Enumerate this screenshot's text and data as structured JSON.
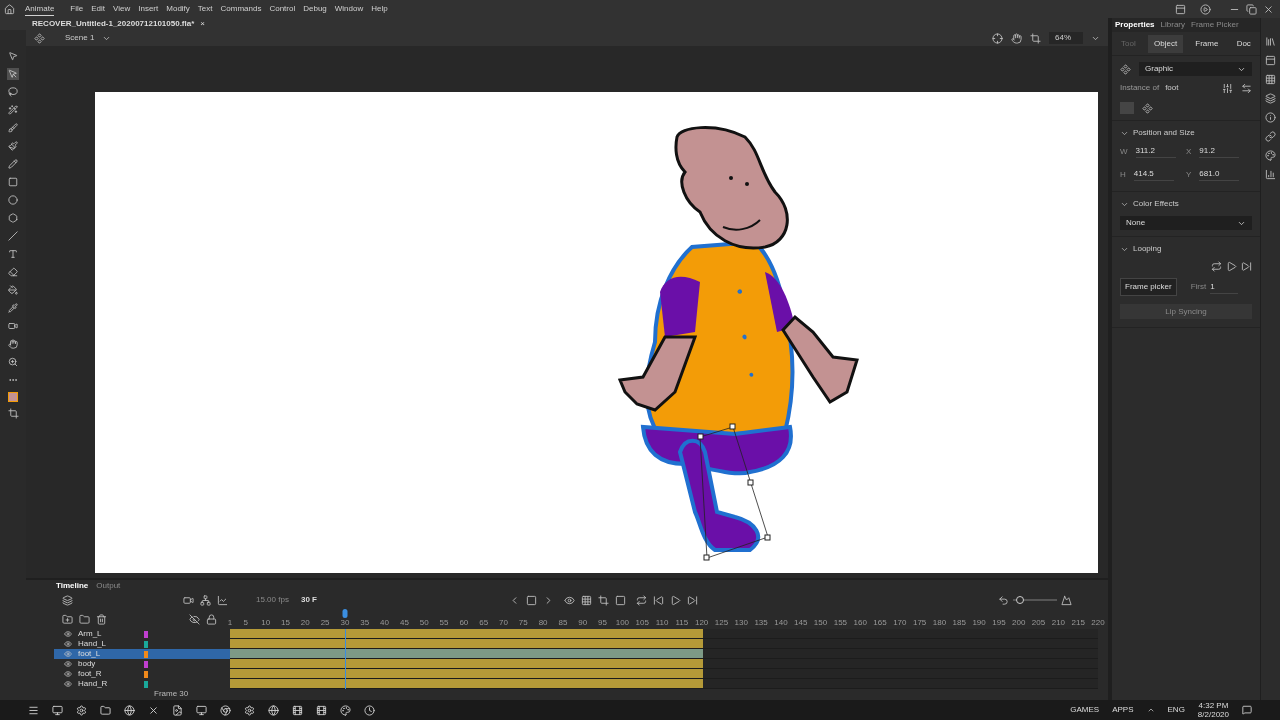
{
  "app": {
    "name": "Animate",
    "menus": [
      "File",
      "Edit",
      "View",
      "Insert",
      "Modify",
      "Text",
      "Commands",
      "Control",
      "Debug",
      "Window",
      "Help"
    ]
  },
  "document_tab": {
    "title": "RECOVER_Untitled-1_20200712101050.fla*",
    "close": "×"
  },
  "scene_bar": {
    "scene": "Scene 1",
    "zoom": "64%"
  },
  "tools": [
    {
      "kind": "select",
      "selected": false
    },
    {
      "kind": "subselect",
      "selected": true
    },
    {
      "kind": "lasso",
      "selected": false
    },
    {
      "kind": "wand",
      "selected": false
    },
    {
      "kind": "brush",
      "selected": false
    },
    {
      "kind": "paintbrush",
      "selected": false
    },
    {
      "kind": "pencil",
      "selected": false
    },
    {
      "kind": "rect",
      "selected": false
    },
    {
      "kind": "oval",
      "selected": false
    },
    {
      "kind": "poly",
      "selected": false
    },
    {
      "kind": "line",
      "selected": false
    },
    {
      "kind": "text",
      "selected": false
    },
    {
      "kind": "eraser",
      "selected": false
    },
    {
      "kind": "bucket",
      "selected": false
    },
    {
      "kind": "eyedropper",
      "selected": false
    },
    {
      "kind": "camera",
      "selected": false
    },
    {
      "kind": "hand",
      "selected": false
    },
    {
      "kind": "zoom",
      "selected": false
    },
    {
      "kind": "more",
      "selected": false
    }
  ],
  "properties": {
    "panel_tabs": [
      {
        "label": "Properties",
        "selected": true
      },
      {
        "label": "Library",
        "selected": false
      },
      {
        "label": "Frame Picker",
        "selected": false
      }
    ],
    "tabs": [
      {
        "label": "Tool",
        "selected": false,
        "disabled": true
      },
      {
        "label": "Object",
        "selected": true,
        "disabled": false
      },
      {
        "label": "Frame",
        "selected": false,
        "disabled": false
      },
      {
        "label": "Doc",
        "selected": false,
        "disabled": false
      }
    ],
    "symbol_type": "Graphic",
    "instance_label": "Instance of",
    "instance_name": "foot",
    "position_size": {
      "title": "Position and Size",
      "expanded": true,
      "fields": [
        {
          "label": "W",
          "value": "311.2"
        },
        {
          "label": "X",
          "value": "91.2"
        },
        {
          "label": "H",
          "value": "414.5"
        },
        {
          "label": "Y",
          "value": "681.0"
        }
      ]
    },
    "color_effects": {
      "title": "Color Effects",
      "expanded": true,
      "value": "None"
    },
    "looping": {
      "title": "Looping",
      "expanded": true,
      "frame_picker": "Frame picker",
      "first_label": "First",
      "first_value": "1",
      "lip_sync": "Lip Syncing",
      "lip_sync_disabled": true
    }
  },
  "timeline": {
    "tabs": [
      {
        "label": "Timeline",
        "selected": true
      },
      {
        "label": "Output",
        "selected": false
      }
    ],
    "fps": "15.00",
    "fps_unit": "fps",
    "current_frame": "30",
    "frame_unit": "F",
    "frame_label": "Frame 30",
    "frames": {
      "level": 0.545
    },
    "zoom_slider": {
      "level": 0.15
    },
    "ruler": [
      "1",
      "5",
      "10",
      "15",
      "20",
      "25",
      "30",
      "35",
      "40",
      "45",
      "50",
      "55",
      "60",
      "65",
      "70",
      "75",
      "80",
      "85",
      "90",
      "95",
      "100",
      "105",
      "110",
      "115",
      "120",
      "125",
      "130",
      "135",
      "140",
      "145",
      "150",
      "155",
      "160",
      "165",
      "170",
      "175",
      "180",
      "185",
      "190",
      "195",
      "200",
      "205",
      "210",
      "215",
      "220"
    ],
    "layers": [
      {
        "name": "Arm_L",
        "selected": false,
        "color": "#c03fd0"
      },
      {
        "name": "Hand_L",
        "selected": false,
        "color": "#1aa89a"
      },
      {
        "name": "foot_L",
        "selected": true,
        "color": "#f08a1c"
      },
      {
        "name": "body",
        "selected": false,
        "color": "#c03fd0"
      },
      {
        "name": "foot_R",
        "selected": false,
        "color": "#f08a1c"
      },
      {
        "name": "Hand_R",
        "selected": false,
        "color": "#1aa89a"
      }
    ]
  },
  "taskbar": {
    "tray": [
      "GAMES",
      "APPS"
    ],
    "language": "ENG",
    "time": "4:32 PM",
    "date": "8/2/2020"
  }
}
